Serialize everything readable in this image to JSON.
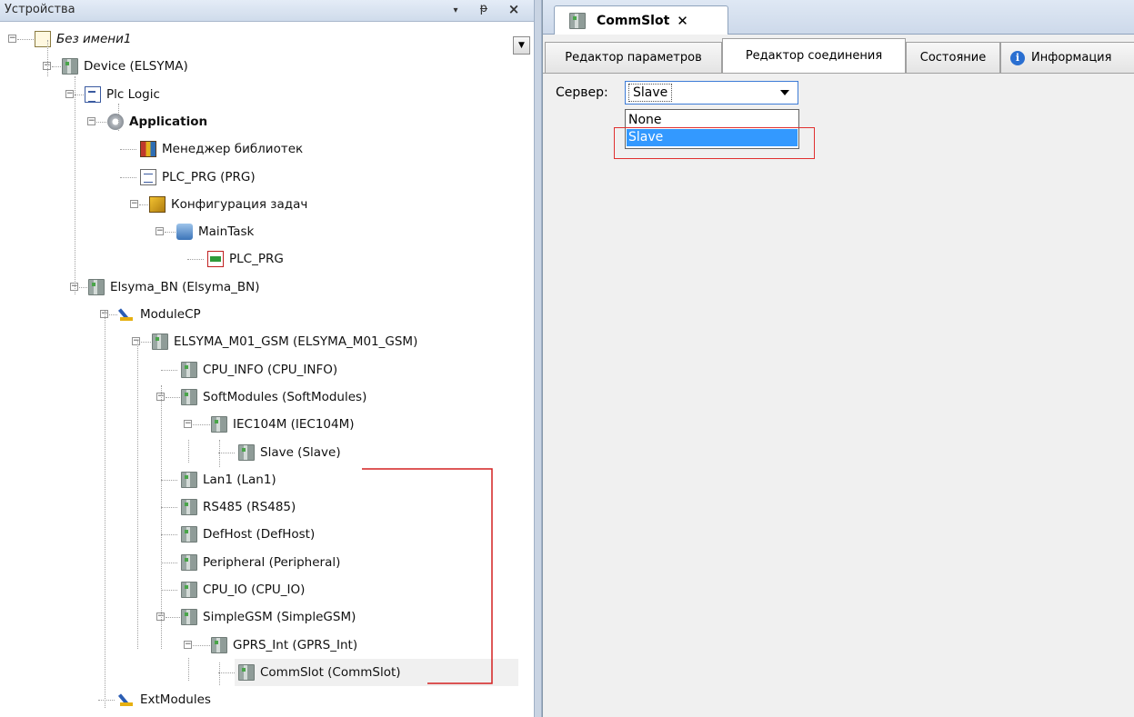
{
  "left_panel": {
    "title": "Устройства",
    "header_buttons": {
      "dropdown": "▾",
      "pin": "ᵽ",
      "close": "×"
    }
  },
  "tree": [
    {
      "id": "project",
      "label": "Без имени1",
      "italic": true,
      "icon": "project-icon",
      "expander": "−"
    },
    {
      "id": "device",
      "label": "Device (ELSYMA)",
      "icon": "device-icon",
      "expander": "−"
    },
    {
      "id": "plc-logic",
      "label": "Plc Logic",
      "icon": "plc-logic-icon",
      "expander": "−"
    },
    {
      "id": "application",
      "label": "Application",
      "bold": true,
      "icon": "gear-icon",
      "expander": "−"
    },
    {
      "id": "lib-manager",
      "label": "Менеджер библиотек",
      "icon": "library-icon"
    },
    {
      "id": "plc-prg",
      "label": "PLC_PRG (PRG)",
      "icon": "document-icon"
    },
    {
      "id": "task-config",
      "label": "Конфигурация задач",
      "icon": "task-config-icon",
      "expander": "−"
    },
    {
      "id": "main-task",
      "label": "MainTask",
      "icon": "task-icon",
      "expander": "−"
    },
    {
      "id": "plc-prg-call",
      "label": "PLC_PRG",
      "icon": "program-call-icon"
    },
    {
      "id": "elsyma-bn",
      "label": "Elsyma_BN (Elsyma_BN)",
      "icon": "device-icon",
      "expander": "−"
    },
    {
      "id": "module-cp",
      "label": "ModuleCP",
      "icon": "module-icon",
      "expander": "−"
    },
    {
      "id": "elsyma-m01",
      "label": "ELSYMA_M01_GSM (ELSYMA_M01_GSM)",
      "icon": "device-icon",
      "expander": "−"
    },
    {
      "id": "cpu-info",
      "label": "CPU_INFO (CPU_INFO)",
      "icon": "device-icon"
    },
    {
      "id": "softmodules",
      "label": "SoftModules (SoftModules)",
      "icon": "device-icon",
      "expander": "−"
    },
    {
      "id": "iec104m",
      "label": "IEC104M (IEC104M)",
      "icon": "device-icon",
      "expander": "−"
    },
    {
      "id": "slave",
      "label": "Slave (Slave)",
      "icon": "device-icon"
    },
    {
      "id": "lan1",
      "label": "Lan1 (Lan1)",
      "icon": "device-icon"
    },
    {
      "id": "rs485",
      "label": "RS485 (RS485)",
      "icon": "device-icon"
    },
    {
      "id": "defhost",
      "label": "DefHost (DefHost)",
      "icon": "device-icon"
    },
    {
      "id": "peripheral",
      "label": "Peripheral (Peripheral)",
      "icon": "device-icon"
    },
    {
      "id": "cpu-io",
      "label": "CPU_IO (CPU_IO)",
      "icon": "device-icon"
    },
    {
      "id": "simplegsm",
      "label": "SimpleGSM (SimpleGSM)",
      "icon": "device-icon",
      "expander": "−"
    },
    {
      "id": "gprs-int",
      "label": "GPRS_Int (GPRS_Int)",
      "icon": "device-icon",
      "expander": "−"
    },
    {
      "id": "commslot",
      "label": "CommSlot (CommSlot)",
      "icon": "device-icon",
      "selected": true
    },
    {
      "id": "ext-modules",
      "label": "ExtModules",
      "icon": "module-icon"
    }
  ],
  "doc_tab": {
    "label": "CommSlot",
    "close": "✕"
  },
  "editor_tabs": [
    {
      "label": "Редактор параметров"
    },
    {
      "label": "Редактор соединения",
      "active": true
    },
    {
      "label": "Состояние"
    },
    {
      "label": "Информация"
    }
  ],
  "info_icon_glyph": "i",
  "server": {
    "label": "Сервер:",
    "selected": "Slave",
    "options": [
      "None",
      "Slave"
    ]
  },
  "colors": {
    "highlight": "#e03030",
    "selection": "#3399ff",
    "connector": "#d42020"
  }
}
